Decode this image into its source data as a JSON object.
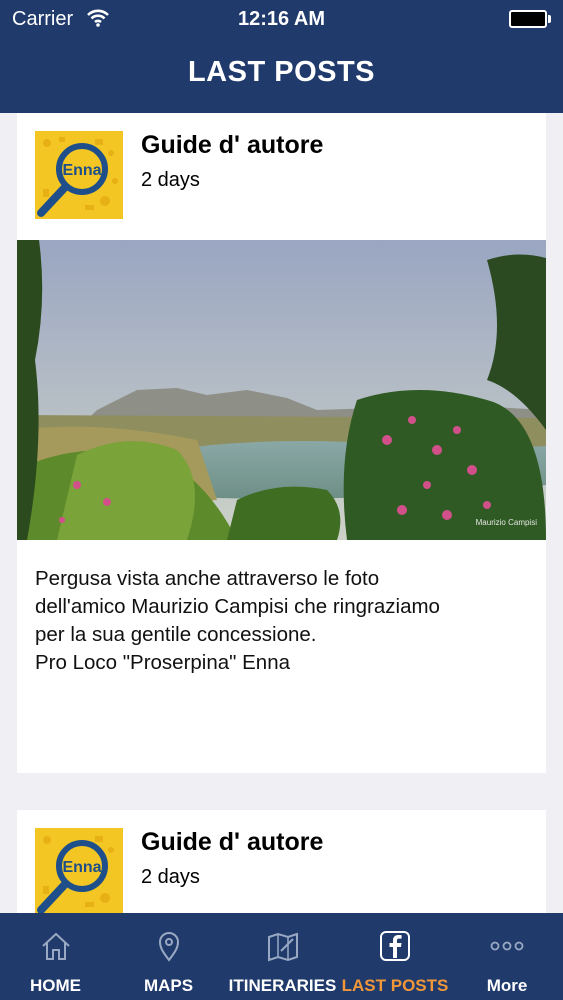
{
  "status_bar": {
    "carrier": "Carrier",
    "time": "12:16 AM"
  },
  "header": {
    "title": "LAST POSTS"
  },
  "posts": [
    {
      "title": "Guide d' autore",
      "time": "2 days",
      "avatar_label": "Enna",
      "photo_credit": "Maurizio Campisi",
      "text": "Pergusa  vista anche attraverso le foto\ndell'amico Maurizio Campisi   che ringraziamo\nper la sua gentile concessione.\nPro Loco \"Proserpina\" Enna"
    },
    {
      "title": "Guide d' autore",
      "time": "2 days",
      "avatar_label": "Enna"
    }
  ],
  "tabbar": {
    "tabs": [
      {
        "label": "HOME",
        "icon": "home-icon"
      },
      {
        "label": "MAPS",
        "icon": "map-pin-icon"
      },
      {
        "label": "ITINERARIES",
        "icon": "map-folded-icon"
      },
      {
        "label": "LAST POSTS",
        "icon": "facebook-icon",
        "active": true
      },
      {
        "label": "More",
        "icon": "more-dots-icon"
      }
    ],
    "active_color": "#f2963a"
  },
  "colors": {
    "nav": "#1f3a6b",
    "background": "#efeff4",
    "avatar_bg": "#f3c624"
  }
}
